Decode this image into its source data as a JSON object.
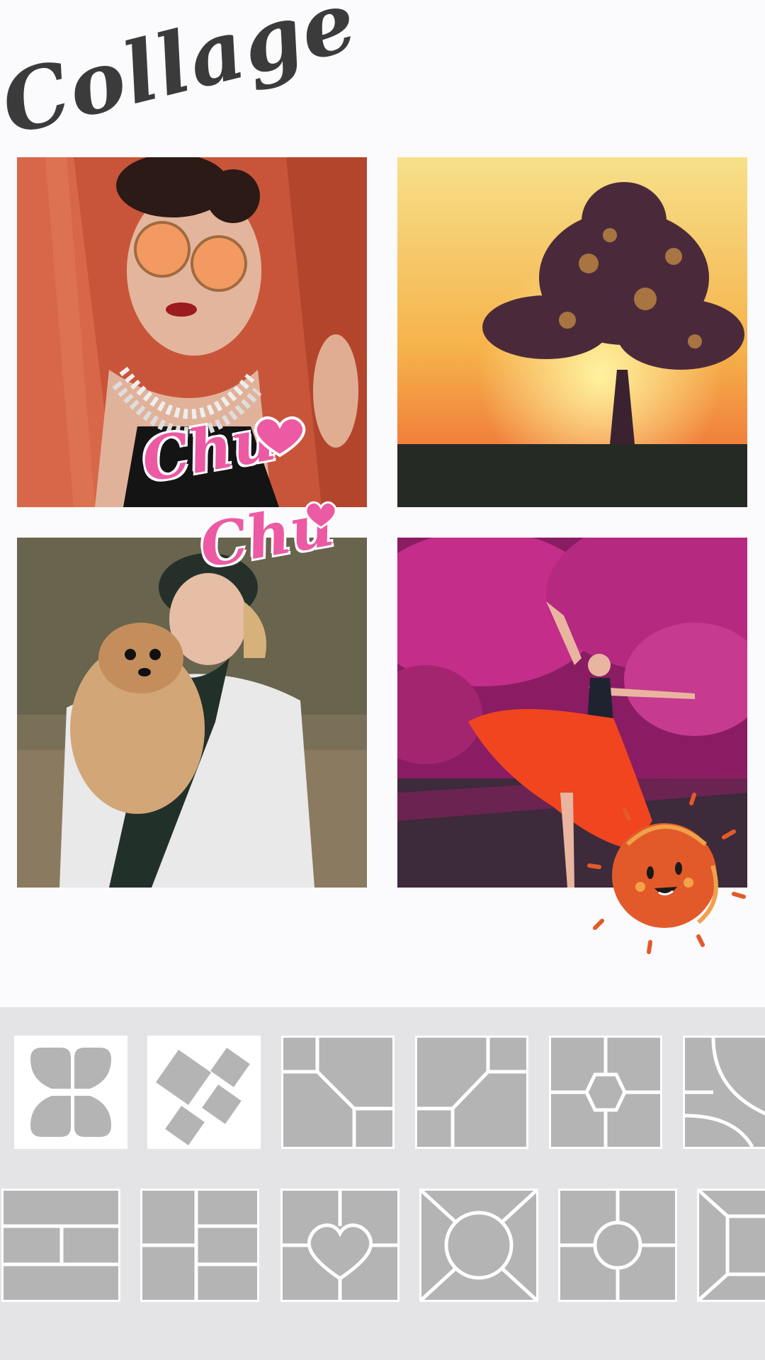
{
  "header": {
    "title": "Collage"
  },
  "stickers": {
    "chu_text_1": "Chu",
    "chu_text_2": "Chu"
  },
  "collage": {
    "photos": [
      {
        "name": "woman-orange-sunglasses"
      },
      {
        "name": "tree-sunset"
      },
      {
        "name": "woman-with-dog"
      },
      {
        "name": "dancer-pink-forest"
      }
    ]
  },
  "layout_panel": {
    "row1": [
      "four-petal",
      "tilted-squares",
      "split-corner-left",
      "split-corner-right",
      "center-hexagon",
      "quarter-arc"
    ],
    "row2": [
      "stripes-three",
      "grid-columns",
      "center-heart",
      "center-circle-x",
      "center-circle-cross",
      "frame-bars"
    ]
  },
  "colors": {
    "accent_pink": "#ec5aa3",
    "sun_orange": "#e35a2a",
    "panel_bg": "#e4e3e6",
    "tile_fill": "#b7b7b7"
  }
}
